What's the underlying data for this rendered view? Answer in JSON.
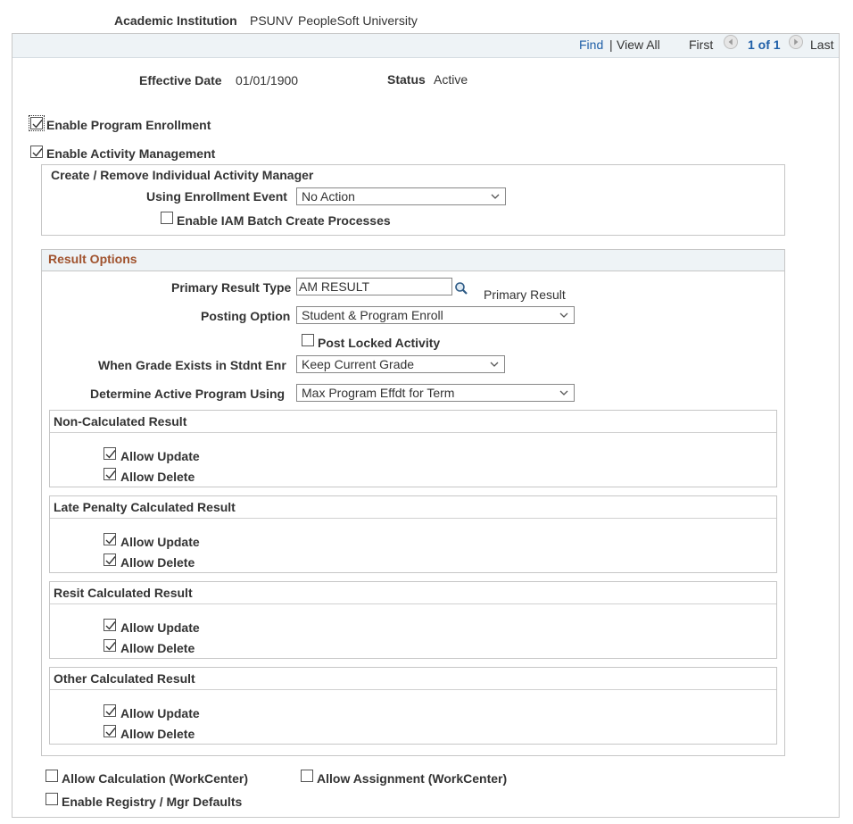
{
  "header": {
    "institution_label": "Academic Institution",
    "institution_code": "PSUNV",
    "institution_name": "PeopleSoft University"
  },
  "nav": {
    "find": "Find",
    "separator": "|",
    "view_all": "View All",
    "first": "First",
    "page": "1 of 1",
    "last": "Last"
  },
  "record": {
    "effective_date_label": "Effective Date",
    "effective_date": "01/01/1900",
    "status_label": "Status",
    "status": "Active"
  },
  "enable_program_enrollment": {
    "label": "Enable Program Enrollment",
    "checked": true
  },
  "enable_activity_management": {
    "label": "Enable Activity Management",
    "checked": true
  },
  "iam": {
    "title": "Create / Remove Individual Activity Manager",
    "event_label": "Using Enrollment Event",
    "event_value": "No Action",
    "batch_label": "Enable IAM Batch Create Processes",
    "batch_checked": false
  },
  "result_options": {
    "title": "Result Options",
    "primary_label": "Primary Result Type",
    "primary_value": "AM RESULT",
    "primary_desc": "Primary Result",
    "posting_label": "Posting Option",
    "posting_value": "Student & Program Enroll",
    "post_locked_label": "Post Locked Activity",
    "post_locked_checked": false,
    "grade_label": "When Grade Exists in Stdnt Enr",
    "grade_value": "Keep Current Grade",
    "active_label": "Determine Active Program Using",
    "active_value": "Max Program Effdt for Term"
  },
  "groups": [
    {
      "title": "Non-Calculated Result",
      "update": "Allow Update",
      "delete": "Allow Delete"
    },
    {
      "title": "Late Penalty Calculated Result",
      "update": "Allow Update",
      "delete": "Allow Delete"
    },
    {
      "title": "Resit Calculated Result",
      "update": "Allow Update",
      "delete": "Allow Delete"
    },
    {
      "title": "Other Calculated Result",
      "update": "Allow Update",
      "delete": "Allow Delete"
    }
  ],
  "footer": {
    "allow_calc": "Allow Calculation (WorkCenter)",
    "allow_assign": "Allow Assignment (WorkCenter)",
    "registry": "Enable Registry / Mgr Defaults"
  },
  "colors": {
    "link": "#1f5fa8",
    "section_title": "#a0522d",
    "header_bg": "#eef3f6"
  },
  "icons": [
    "checkmark-icon",
    "chevron-down-icon",
    "search-icon",
    "arrow-left-icon",
    "arrow-right-icon"
  ]
}
